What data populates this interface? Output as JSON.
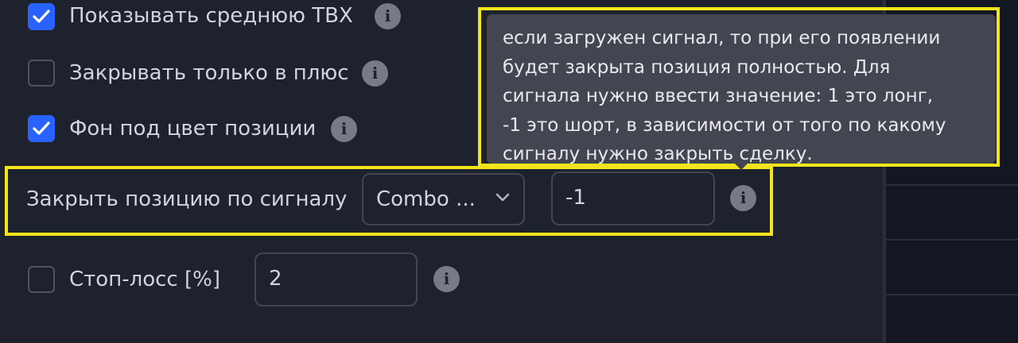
{
  "settings": {
    "show_avg_tvx": {
      "label": "Показывать среднюю ТВХ",
      "checked": true
    },
    "close_only_profit": {
      "label": "Закрывать только в плюс",
      "checked": false
    },
    "bg_position_color": {
      "label": "Фон под цвет позиции",
      "checked": true
    },
    "close_by_signal": {
      "label": "Закрыть позицию по сигналу",
      "select_value": "Combo ...",
      "input_value": "-1"
    },
    "stop_loss": {
      "label": "Стоп-лосс [%]",
      "checked": false,
      "input_value": "2"
    }
  },
  "tooltip": {
    "lines": [
      "если загружен сигнал, то при его появлении",
      "будет закрыта позиция полностью. Для",
      "сигнала нужно ввести значение: 1 это лонг,",
      "-1 это шорт, в зависимости от того по какому",
      "сигналу нужно закрыть сделку."
    ]
  },
  "icons": {
    "info": "i"
  },
  "colors": {
    "background": "#1e222d",
    "checkbox_on": "#2962ff",
    "highlight": "#f2e51a",
    "tooltip_bg": "#434651"
  }
}
